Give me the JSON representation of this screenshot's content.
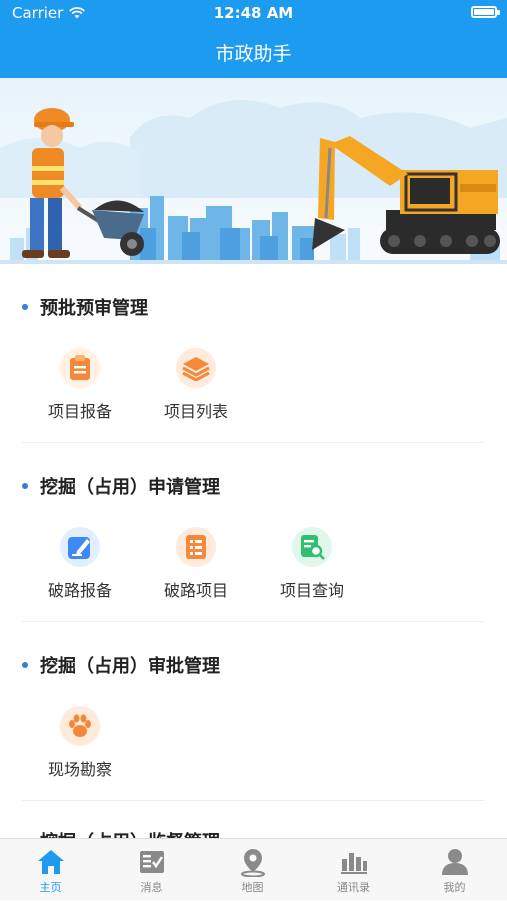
{
  "status_bar": {
    "carrier": "Carrier",
    "time": "12:48 AM"
  },
  "nav": {
    "title": "市政助手"
  },
  "sections": [
    {
      "title": "预批预审管理",
      "items": [
        {
          "label": "项目报备",
          "icon": "clipboard-icon"
        },
        {
          "label": "项目列表",
          "icon": "layers-icon"
        }
      ]
    },
    {
      "title": "挖掘（占用）申请管理",
      "items": [
        {
          "label": "破路报备",
          "icon": "edit-icon"
        },
        {
          "label": "破路项目",
          "icon": "list-icon"
        },
        {
          "label": "项目查询",
          "icon": "document-search-icon"
        }
      ]
    },
    {
      "title": "挖掘（占用）审批管理",
      "items": [
        {
          "label": "现场勘察",
          "icon": "paw-icon"
        }
      ]
    },
    {
      "title": "挖掘（占用）监督管理",
      "items": []
    }
  ],
  "tabs": [
    {
      "label": "主页",
      "icon": "home-icon",
      "active": true
    },
    {
      "label": "消息",
      "icon": "message-icon",
      "active": false
    },
    {
      "label": "地图",
      "icon": "map-pin-icon",
      "active": false
    },
    {
      "label": "通讯录",
      "icon": "contacts-icon",
      "active": false
    },
    {
      "label": "我的",
      "icon": "user-icon",
      "active": false
    }
  ],
  "colors": {
    "primary": "#1d9bf0",
    "section_dot": "#3a7bd5",
    "orange": "#f5893b",
    "blue_icon": "#3d8af7",
    "green_icon": "#2fbf71",
    "tab_inactive": "#888888"
  }
}
